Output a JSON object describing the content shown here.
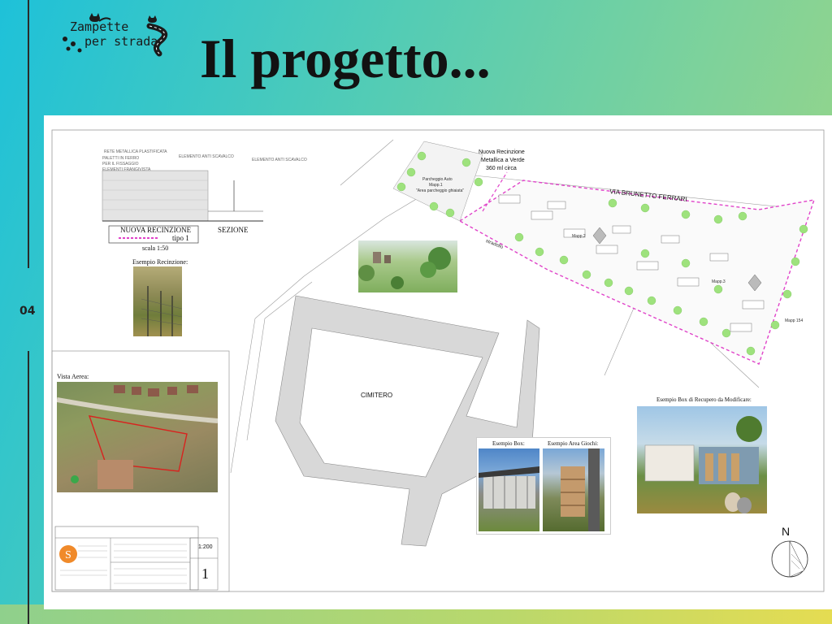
{
  "slide": {
    "page_number": "04",
    "title": "Il progetto...",
    "logo": {
      "line1": "Zampette",
      "line2": "per strada"
    }
  },
  "plan": {
    "fence_section": {
      "fence_label": "NUOVA RECINZIONE",
      "fence_type": "tipo 1",
      "section_label": "SEZIONE",
      "scale": "scala 1:50",
      "example_fence": "Esempio Recinzione:",
      "notes": [
        "RETE METALLICA PLASTIFICATA",
        "ELEMENTO ANTI SCAVALCO",
        "PALETTI IN FERRO",
        "PER IL FISSAGGIO",
        "ELEMENTI FRANGIVISTA",
        "ELEMENTO ANTI SCAVALCO"
      ]
    },
    "aerial": {
      "label": "Vista Aerea:"
    },
    "cemetery": "CIMITERO",
    "street": "VIA BRUNETTO FERRARI",
    "stradello": "stradello",
    "new_fence": {
      "line1": "Nuova Recinzione",
      "line2": "Metallica a Verde",
      "line3": "360 ml circa"
    },
    "parking": {
      "line1": "Parcheggio Auto",
      "line2": "Mapp.1",
      "line3": "\"Area parcheggio ghiaiata\""
    },
    "parcels": [
      "Mapp.2",
      "Mapp.3",
      "Mapp 154"
    ],
    "example_box_recovery": "Esempio Box di Recupero da Modificare:",
    "example_box": "Esempio Box:",
    "example_play_area": "Esempio Area Giochi:",
    "north": "N",
    "title_block": {
      "scale": "1:200",
      "sheet": "1"
    }
  }
}
